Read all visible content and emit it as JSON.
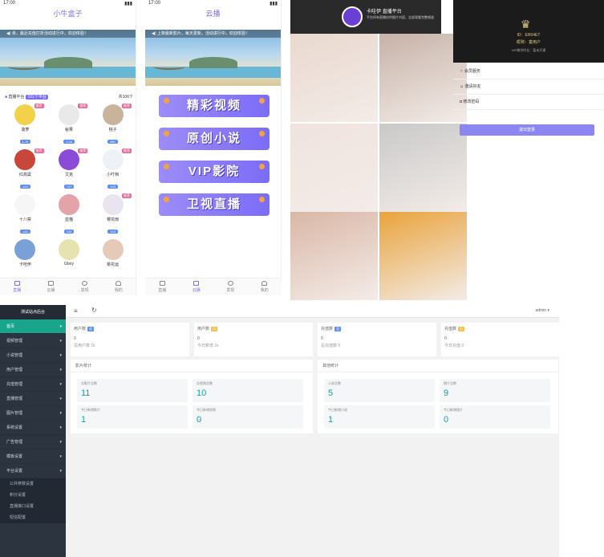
{
  "phone1": {
    "status": "17:00",
    "title": "小牛盒子",
    "notice": "亲，最近充值打折活动进行中，欢迎体验！",
    "live_head": "直播平台",
    "live_tag": "101个平台",
    "live_count": "共106个",
    "avatars": [
      {
        "name": "菠萝",
        "count": "1.7k",
        "badge": "推荐",
        "color": "#f2d24b"
      },
      {
        "name": "秘果",
        "count": "1.2k",
        "badge": "推荐",
        "color": "#e9e9e9"
      },
      {
        "name": "桃子",
        "count": "881",
        "badge": "推荐",
        "color": "#c8b49a"
      },
      {
        "name": "红高粱",
        "count": "143",
        "badge": "推荐",
        "color": "#c9473a"
      },
      {
        "name": "艾克",
        "count": "737",
        "badge": "推荐",
        "color": "#8b4bd8"
      },
      {
        "name": "小叮档",
        "count": "143",
        "badge": "推荐",
        "color": "#eef2f6"
      },
      {
        "name": "十八禁",
        "count": "143",
        "badge": "",
        "color": "#f6f6f6"
      },
      {
        "name": "蓝猫",
        "count": "154",
        "badge": "",
        "color": "#e4a3a8"
      },
      {
        "name": "樱花雨",
        "count": "143",
        "badge": "推荐",
        "color": "#eae3f0"
      },
      {
        "name": "卡哇伊",
        "count": "",
        "badge": "",
        "color": "#7aa0d8"
      },
      {
        "name": "Gboy",
        "count": "",
        "badge": "",
        "color": "#e6e3b0"
      },
      {
        "name": "桃花运",
        "count": "",
        "badge": "",
        "color": "#e7c9b8"
      }
    ],
    "tabs": [
      "直播",
      "云播",
      "发现",
      "我的"
    ]
  },
  "phone2": {
    "status": "17:00",
    "title": "云播",
    "notice": "上架最新影片，每天更新，活动进行中，欢迎体验！",
    "buttons": [
      "精彩视频",
      "原创小说",
      "VIP影院",
      "卫视直播"
    ],
    "tabs": [
      "直播",
      "云播",
      "发现",
      "我的"
    ],
    "button_color": "#8c7cf7"
  },
  "phone3": {
    "brand": "卡哇伊",
    "brand_sub": "直播平台",
    "desc": "平台所有直播仅供图片内容，全部观看完整频道",
    "photos": [
      {
        "label": "",
        "views": "",
        "tone": "#e9d8cf"
      },
      {
        "label": "",
        "views": "",
        "tone": "#c6b2a8"
      },
      {
        "label": "",
        "views": "",
        "tone": "#efe3df"
      },
      {
        "label": "",
        "views": "",
        "tone": "#c9c9c9"
      },
      {
        "label": "",
        "views": "",
        "tone": "#d9b7a7"
      },
      {
        "label": "",
        "views": "",
        "tone": "#e9a33d"
      }
    ]
  },
  "phone4": {
    "id_line": "ID：ER04ET",
    "level_line": "昵称：童用户",
    "vip_line": "VIP剩余时长：暂未开通",
    "menu": [
      "会员服务",
      "邀请好友",
      "修改密码"
    ],
    "logout": "退出登录"
  },
  "admin": {
    "brand": "测试站点后台",
    "user": "admin",
    "nav": [
      {
        "label": "首页",
        "active": true
      },
      {
        "label": "视频管理",
        "active": false
      },
      {
        "label": "小说管理",
        "active": false
      },
      {
        "label": "用户管理",
        "active": false
      },
      {
        "label": "充值管理",
        "active": false
      },
      {
        "label": "直播管理",
        "active": false
      },
      {
        "label": "图片管理",
        "active": false
      },
      {
        "label": "系统设置",
        "active": false
      },
      {
        "label": "广告管理",
        "active": false
      },
      {
        "label": "模板设置",
        "active": false
      },
      {
        "label": "平台设置",
        "active": false
      }
    ],
    "subnav": [
      "公共参数设置",
      "积分设置",
      "直播接口设置",
      "短信配置"
    ],
    "cards": [
      {
        "title": "用户数",
        "chip": "总",
        "chip_color": "#5b8ff9",
        "value": "0",
        "sub": "总用户数 1k"
      },
      {
        "title": "用户数",
        "chip": "日",
        "chip_color": "#f2c14b",
        "value": "0",
        "sub": "今日新增 1k"
      },
      {
        "title": "充值数",
        "chip": "总",
        "chip_color": "#5b8ff9",
        "value": "0",
        "sub": "总充值数 0"
      },
      {
        "title": "充值数",
        "chip": "日",
        "chip_color": "#f2c14b",
        "value": "0",
        "sub": "今日充值 0"
      }
    ],
    "panel1_title": "影片统计",
    "panel2_title": "其他统计",
    "stats": [
      {
        "label": "总影片总数",
        "value": "11"
      },
      {
        "label": "总视频总数",
        "value": "10"
      },
      {
        "label": "小说总数",
        "value": "5"
      },
      {
        "label": "图片总数",
        "value": "9"
      },
      {
        "label": "今日新增影片",
        "value": "1"
      },
      {
        "label": "今日新增视频",
        "value": "0"
      },
      {
        "label": "今日新增小说",
        "value": "1"
      },
      {
        "label": "今日新增图片",
        "value": "0"
      }
    ]
  }
}
